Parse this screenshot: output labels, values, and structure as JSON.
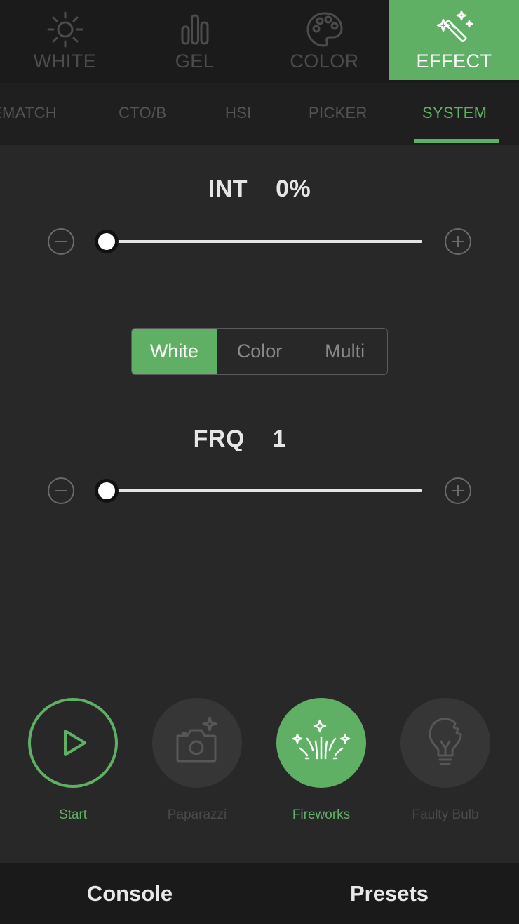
{
  "mode_tabs": [
    {
      "label": "WHITE",
      "icon": "sun-icon",
      "active": false
    },
    {
      "label": "GEL",
      "icon": "bar-chart-icon",
      "active": false
    },
    {
      "label": "COLOR",
      "icon": "palette-icon",
      "active": false
    },
    {
      "label": "EFFECT",
      "icon": "magic-wand-icon",
      "active": true
    }
  ],
  "sub_tabs": [
    {
      "label": "EMATCH",
      "active": false
    },
    {
      "label": "CTO/B",
      "active": false
    },
    {
      "label": "HSI",
      "active": false
    },
    {
      "label": "PICKER",
      "active": false
    },
    {
      "label": "SYSTEM",
      "active": true
    }
  ],
  "int_slider": {
    "label": "INT",
    "value_text": "0%",
    "value": 0
  },
  "mode_segment": {
    "options": [
      "White",
      "Color",
      "Multi"
    ],
    "selected": "White"
  },
  "frq_slider": {
    "label": "FRQ",
    "value_text": "1",
    "value": 1
  },
  "effects": [
    {
      "label": "Start",
      "icon": "play-icon",
      "state": "outline-green"
    },
    {
      "label": "Paparazzi",
      "icon": "camera-sparkle-icon",
      "state": "inactive"
    },
    {
      "label": "Fireworks",
      "icon": "fireworks-icon",
      "state": "selected"
    },
    {
      "label": "Faulty Bulb",
      "icon": "broken-bulb-icon",
      "state": "inactive"
    }
  ],
  "bottom_bar": {
    "console_label": "Console",
    "presets_label": "Presets"
  },
  "colors": {
    "accent": "#5fb065",
    "background": "#282828",
    "top_bar": "#1b1b1b",
    "inactive_text": "#4c4c4c"
  }
}
